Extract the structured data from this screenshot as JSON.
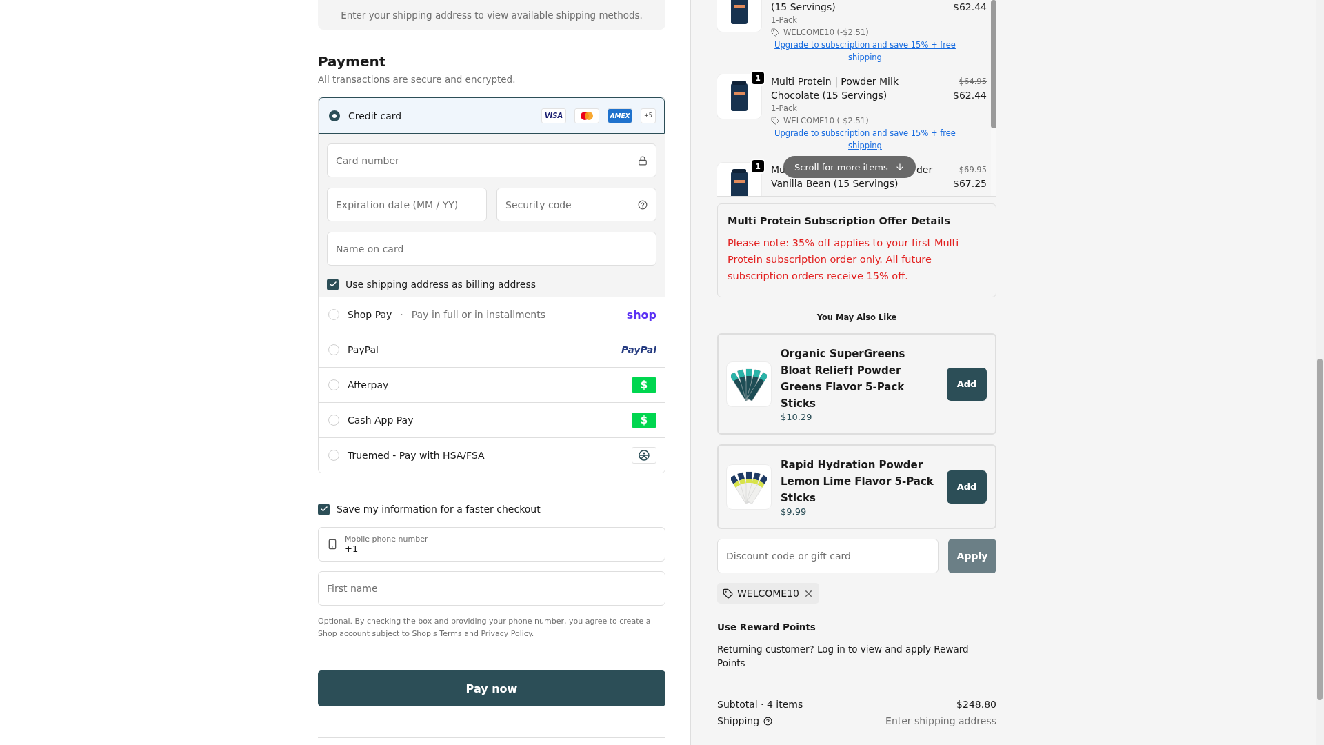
{
  "shipping_notice": "Enter your shipping address to view available shipping methods.",
  "payment": {
    "title": "Payment",
    "subtitle": "All transactions are secure and encrypted.",
    "card": {
      "label": "Credit card",
      "selected": true,
      "brands": [
        {
          "kind": "visa",
          "text": "VISA"
        },
        {
          "kind": "mastercard"
        },
        {
          "kind": "amex",
          "text": "AMEX"
        }
      ],
      "more_brands": "+5",
      "fields": {
        "card_number": "Card number",
        "expiration": "Expiration date (MM / YY)",
        "security_code": "Security code",
        "name_on_card": "Name on card"
      },
      "billing": {
        "label": "Use shipping address as billing address",
        "checked": true
      }
    },
    "methods": [
      {
        "kind": "shop",
        "label": "Shop Pay",
        "separator": "·",
        "note": "Pay in full or in installments",
        "logo_text": "shop",
        "selected": false
      },
      {
        "kind": "paypal",
        "label": "PayPal",
        "logo_text": "PayPal",
        "selected": false
      },
      {
        "kind": "cash",
        "label": "Afterpay",
        "logo_text": "$",
        "selected": false
      },
      {
        "kind": "cash",
        "label": "Cash App Pay",
        "logo_text": "$",
        "selected": false
      },
      {
        "kind": "truemed",
        "label": "Truemed - Pay with HSA/FSA",
        "selected": false
      }
    ]
  },
  "remember": {
    "label": "Save my information for a faster checkout",
    "checked": true,
    "phone": {
      "label": "Mobile phone number",
      "value": "+1"
    },
    "first_name": {
      "placeholder": "First name"
    },
    "legal": {
      "text": "Optional. By checking the box and providing your phone number, you agree to create a Shop account subject to Shop's",
      "terms": "Terms",
      "joiner": "and",
      "privacy": "Privacy Policy",
      "end": "."
    }
  },
  "pay_button": "Pay now",
  "cart_items": [
    {
      "title_parts": [
        "(15 Servings)"
      ],
      "variant": "1-Pack",
      "discount": "WELCOME10 (-$2.51)",
      "upgrade": "Upgrade to subscription and save 15% + free shipping",
      "price": "$62.44"
    },
    {
      "quantity": "1",
      "title_parts": [
        "Multi Protein | Powder Milk Chocolate (15 Servings)"
      ],
      "variant": "1-Pack",
      "discount": "WELCOME10 (-$2.51)",
      "upgrade": "Upgrade to subscription and save 15% + free shipping",
      "original_price": "$64.95",
      "price": "$62.44"
    },
    {
      "quantity": "1",
      "title_parts": [
        "Mu",
        "der",
        "Vanilla Bean (15 Servings)"
      ],
      "original_price": "$69.95",
      "price": "$67.25"
    }
  ],
  "scroll_hint": "Scroll for more items",
  "offer": {
    "title": "Multi Protein Subscription Offer Details",
    "note": "Please note: 35% off applies to your first Multi Protein subscription order only. All future subscription orders receive 15% off."
  },
  "upsell": {
    "title": "You May Also Like",
    "products": [
      {
        "kind": "greens",
        "name": "Organic SuperGreens Bloat Relief† Powder Greens Flavor 5-Pack Sticks",
        "price": "$10.29",
        "button": "Add"
      },
      {
        "kind": "hydration",
        "name": "Rapid Hydration Powder Lemon Lime Flavor 5-Pack Sticks",
        "price": "$9.99",
        "button": "Add"
      }
    ]
  },
  "discount": {
    "placeholder": "Discount code or gift card",
    "button": "Apply",
    "disabled": true
  },
  "applied_codes": [
    {
      "code": "WELCOME10"
    }
  ],
  "rewards": {
    "title": "Use Reward Points",
    "text": "Returning customer? Log in to view and apply Reward Points"
  },
  "summary": [
    {
      "kind": "amount",
      "label": "Subtotal · 4 items",
      "value": "$248.80"
    },
    {
      "kind": "pending",
      "label": "Shipping",
      "value": "Enter shipping address"
    }
  ]
}
